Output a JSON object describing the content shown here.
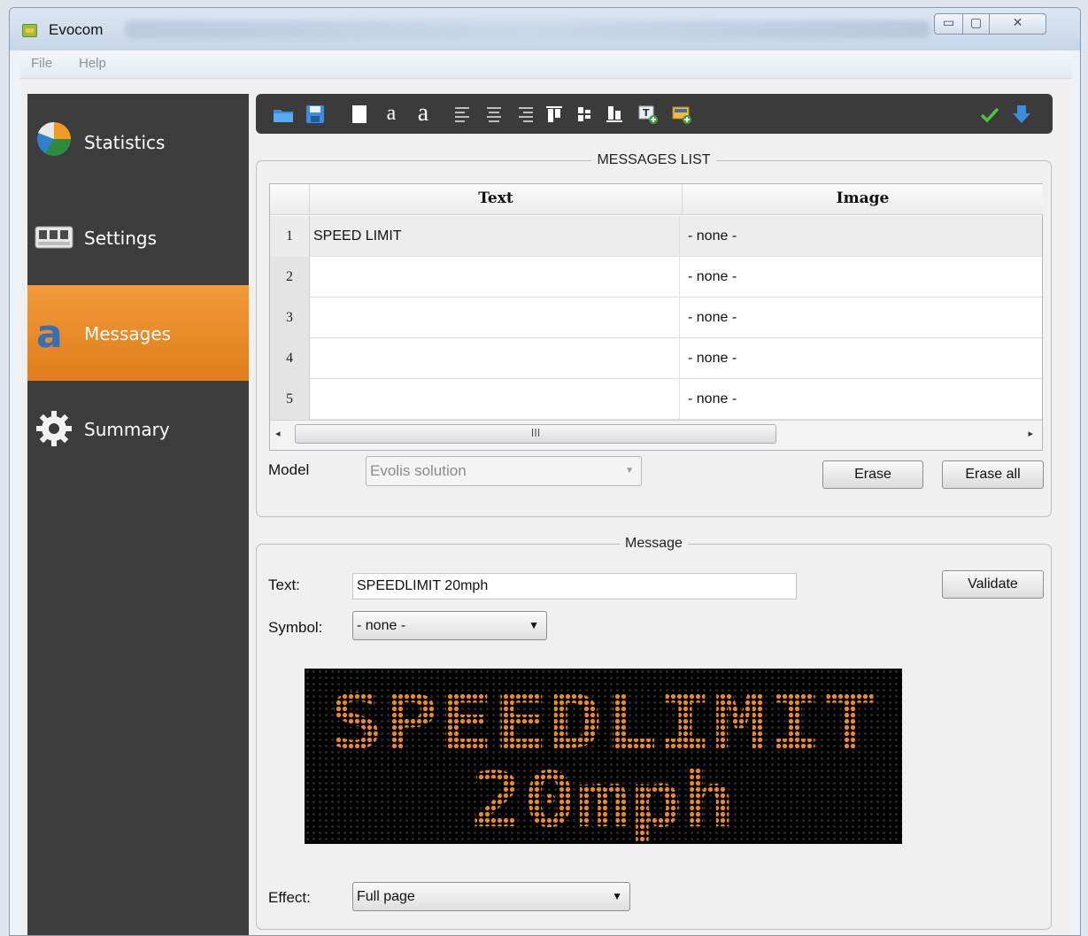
{
  "window": {
    "title": "Evocom",
    "min_glyph": "▭",
    "max_glyph": "▢",
    "close_glyph": "✕"
  },
  "menubar": {
    "file": "File",
    "help": "Help"
  },
  "sidebar": {
    "items": [
      {
        "label": "Statistics",
        "icon": "statistics-pie-icon",
        "active": false
      },
      {
        "label": "Settings",
        "icon": "settings-device-icon",
        "active": false
      },
      {
        "label": "Messages",
        "icon": "messages-letter-a-icon",
        "active": true
      },
      {
        "label": "Summary",
        "icon": "summary-gear-icon",
        "active": false
      }
    ]
  },
  "toolbar": {
    "icons": [
      "open-folder-icon",
      "save-icon",
      "blank-page-icon",
      "font-decrease-icon",
      "font-increase-icon",
      "align-left-icon",
      "align-center-icon",
      "align-right-icon",
      "align-top-icon",
      "align-middle-icon",
      "align-bottom-icon",
      "insert-text-icon",
      "insert-image-icon",
      "check-icon",
      "download-icon"
    ],
    "font_small_glyph": "a",
    "font_large_glyph": "a"
  },
  "messages_list": {
    "legend": "MESSAGES LIST",
    "columns": {
      "text": "Text",
      "image": "Image"
    },
    "rows": [
      {
        "num": "1",
        "text": "SPEED LIMIT",
        "image": "- none -"
      },
      {
        "num": "2",
        "text": "",
        "image": "- none -"
      },
      {
        "num": "3",
        "text": "",
        "image": "- none -"
      },
      {
        "num": "4",
        "text": "",
        "image": "- none -"
      },
      {
        "num": "5",
        "text": "",
        "image": "- none -"
      }
    ],
    "selected_row": 1,
    "scroll": {
      "left": "◂",
      "right": "▸",
      "thumb": "III"
    },
    "model_label": "Model",
    "model_value": "Evolis solution",
    "model_arrow": "▼",
    "erase": "Erase",
    "erase_all": "Erase all"
  },
  "message": {
    "legend": "Message",
    "text_label": "Text:",
    "text_value": "SPEEDLIMIT 20mph",
    "validate": "Validate",
    "symbol_label": "Symbol:",
    "symbol_value": "- none -",
    "effect_label": "Effect:",
    "effect_value": "Full page",
    "combo_arrow": "▼",
    "display": {
      "line1": "SPEEDLIMIT",
      "line2": "20mph",
      "led_color": "#f08a1c",
      "bg_color": "#000000"
    }
  }
}
